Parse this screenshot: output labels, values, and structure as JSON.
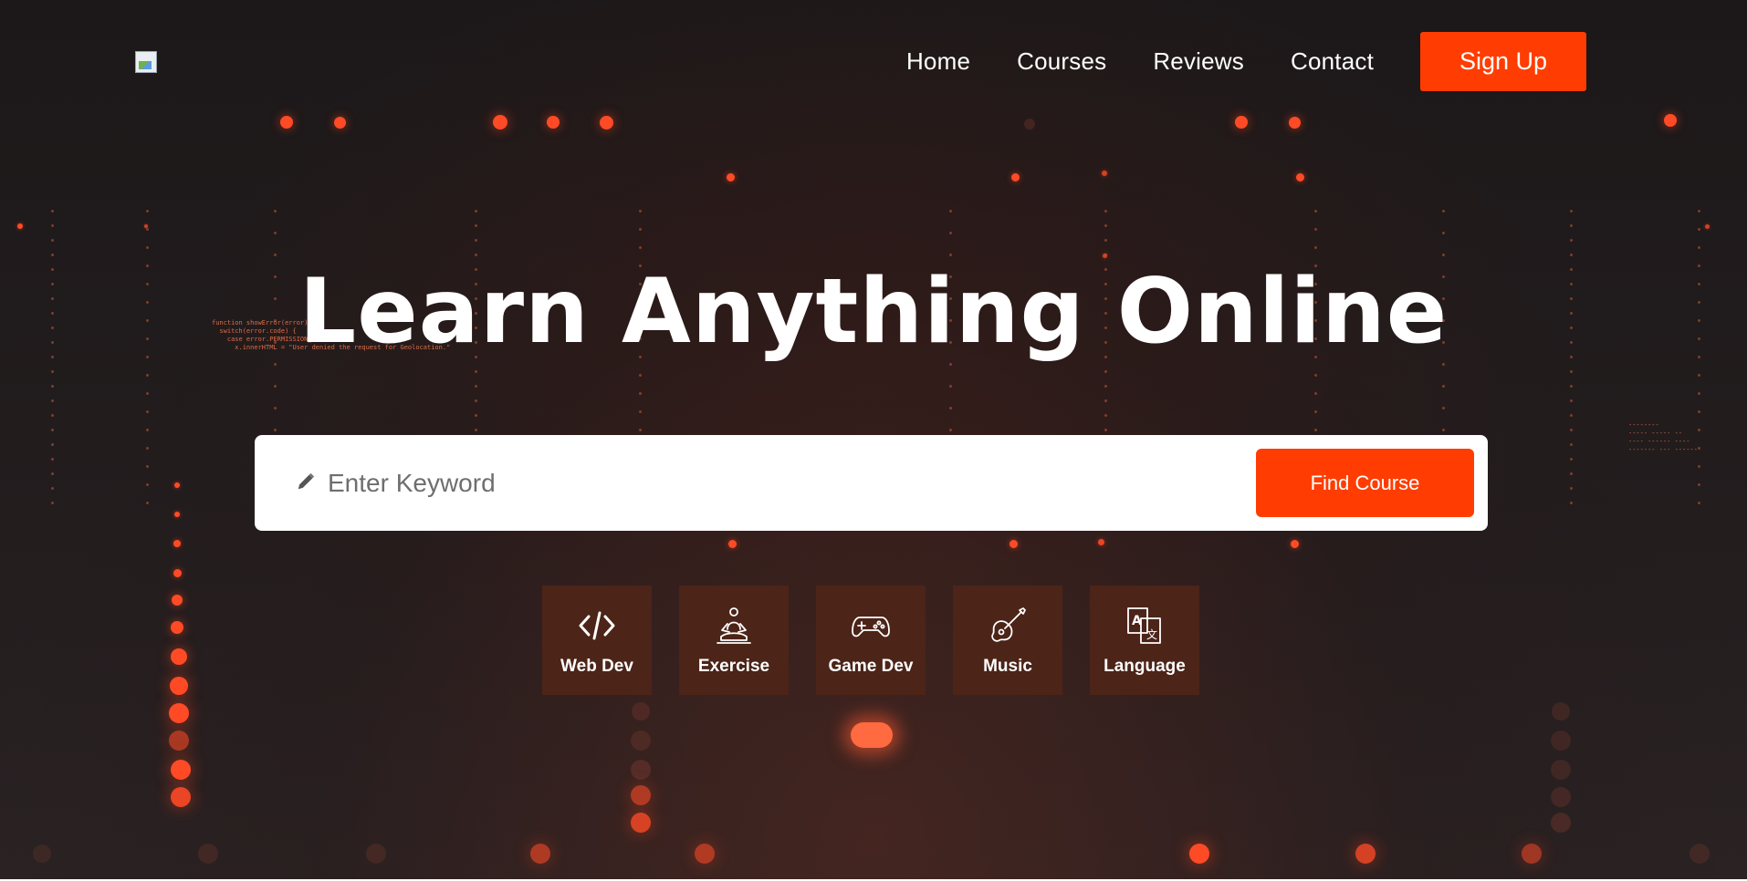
{
  "nav": {
    "links": [
      "Home",
      "Courses",
      "Reviews",
      "Contact"
    ],
    "signup_label": "Sign Up"
  },
  "hero": {
    "title": "Learn Anything Online"
  },
  "search": {
    "placeholder": "Enter Keyword",
    "value": "",
    "button_label": "Find Course",
    "icon": "pencil-icon"
  },
  "categories": [
    {
      "label": "Web Dev",
      "icon": "code-icon"
    },
    {
      "label": "Exercise",
      "icon": "meditation-icon"
    },
    {
      "label": "Game Dev",
      "icon": "gamepad-icon"
    },
    {
      "label": "Music",
      "icon": "guitar-icon"
    },
    {
      "label": "Language",
      "icon": "translate-icon"
    }
  ],
  "colors": {
    "accent": "#ff3d02",
    "category_tile": "#4c2418",
    "text": "#ffffff"
  }
}
